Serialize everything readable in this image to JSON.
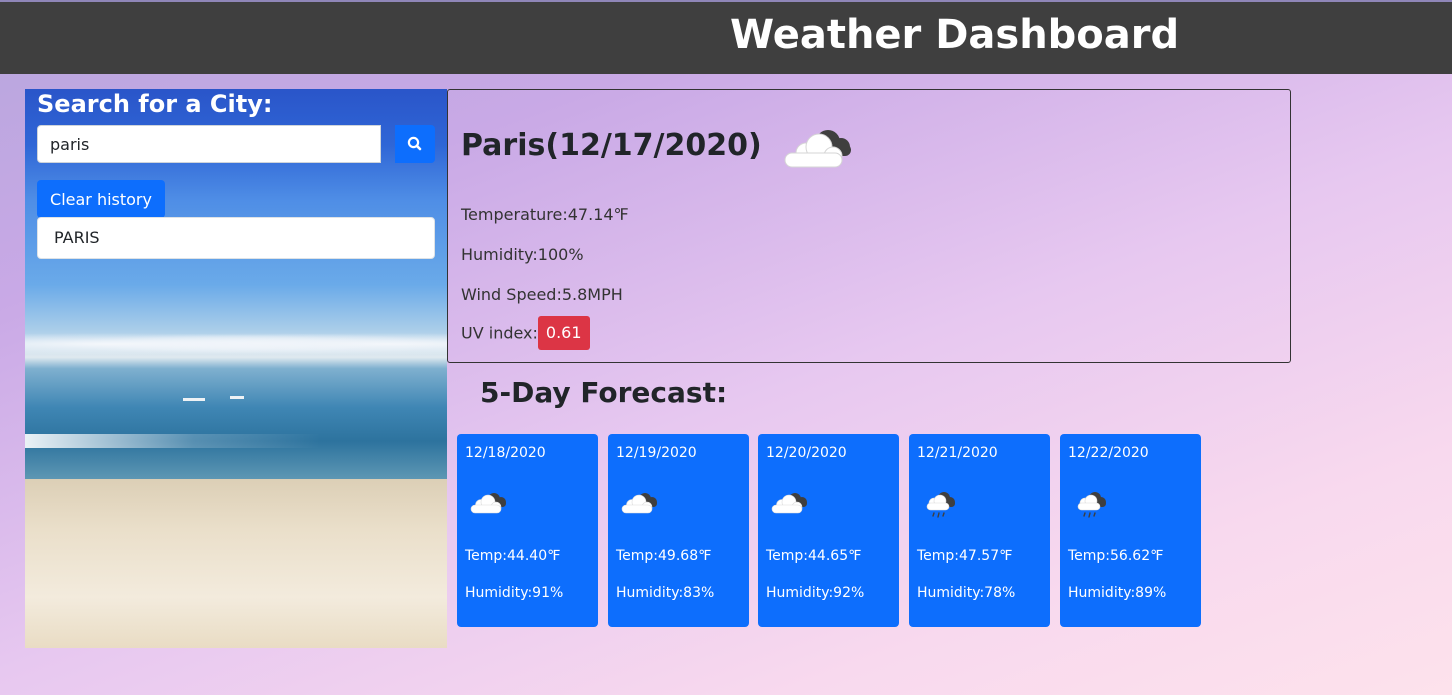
{
  "header": {
    "title": "Weather Dashboard"
  },
  "search": {
    "title": "Search for a City:",
    "input_value": "paris",
    "clear_label": "Clear history",
    "history": [
      "PARIS"
    ]
  },
  "current": {
    "city_title": "Paris(12/17/2020)",
    "icon": "cloudy-icon",
    "temperature_label": "Temperature:",
    "temperature": "47.14℉",
    "humidity_label": "Humidity:",
    "humidity": "100%",
    "wind_label": "Wind Speed:",
    "wind": "5.8MPH",
    "uv_label": "UV index:",
    "uv": "0.61",
    "uv_color": "#dc3545"
  },
  "forecast": {
    "title": "5-Day Forecast:",
    "days": [
      {
        "date": "12/18/2020",
        "icon": "cloudy-icon",
        "temp": "Temp:44.40℉",
        "humidity": "Humidity:91%"
      },
      {
        "date": "12/19/2020",
        "icon": "cloudy-icon",
        "temp": "Temp:49.68℉",
        "humidity": "Humidity:83%"
      },
      {
        "date": "12/20/2020",
        "icon": "cloudy-icon",
        "temp": "Temp:44.65℉",
        "humidity": "Humidity:92%"
      },
      {
        "date": "12/21/2020",
        "icon": "rain-cloud-icon",
        "temp": "Temp:47.57℉",
        "humidity": "Humidity:78%"
      },
      {
        "date": "12/22/2020",
        "icon": "rain-cloud-icon",
        "temp": "Temp:56.62℉",
        "humidity": "Humidity:89%"
      }
    ]
  },
  "colors": {
    "header_bg": "#3f3f3f",
    "primary": "#0d6efd",
    "uv_danger": "#dc3545"
  }
}
